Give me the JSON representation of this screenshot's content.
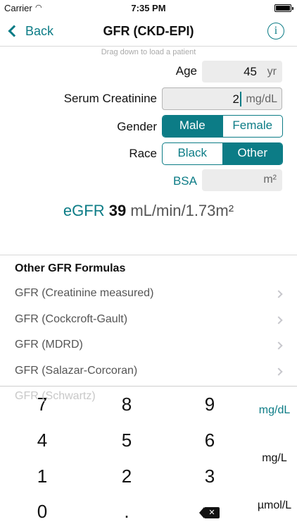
{
  "status_bar": {
    "carrier": "Carrier",
    "time": "7:35 PM"
  },
  "nav": {
    "back_label": "Back",
    "title": "GFR (CKD-EPI)",
    "info_glyph": "i"
  },
  "hint": "Drag down to load a patient",
  "form": {
    "age": {
      "label": "Age",
      "value": "45",
      "unit": "yr"
    },
    "creatinine": {
      "label": "Serum Creatinine",
      "value": "2",
      "unit": "mg/dL"
    },
    "gender": {
      "label": "Gender",
      "options": [
        "Male",
        "Female"
      ],
      "selected": "Male"
    },
    "race": {
      "label": "Race",
      "options": [
        "Black",
        "Other"
      ],
      "selected": "Other"
    },
    "bsa": {
      "label": "BSA",
      "value": "",
      "unit": "m²"
    }
  },
  "result": {
    "label": "eGFR",
    "value": "39",
    "unit": "mL/min/1.73m²"
  },
  "other_formulas": {
    "title": "Other GFR Formulas",
    "items": [
      "GFR (Creatinine measured)",
      "GFR (Cockcroft-Gault)",
      "GFR (MDRD)",
      "GFR (Salazar-Corcoran)"
    ],
    "partial_item": "GFR (Schwartz)"
  },
  "keypad": {
    "keys": [
      "7",
      "8",
      "9",
      "4",
      "5",
      "6",
      "1",
      "2",
      "3",
      "0",
      "."
    ],
    "units": [
      "mg/dL",
      "mg/L",
      "µmol/L"
    ],
    "selected_unit": "mg/dL"
  },
  "colors": {
    "accent": "#0c7c86"
  }
}
